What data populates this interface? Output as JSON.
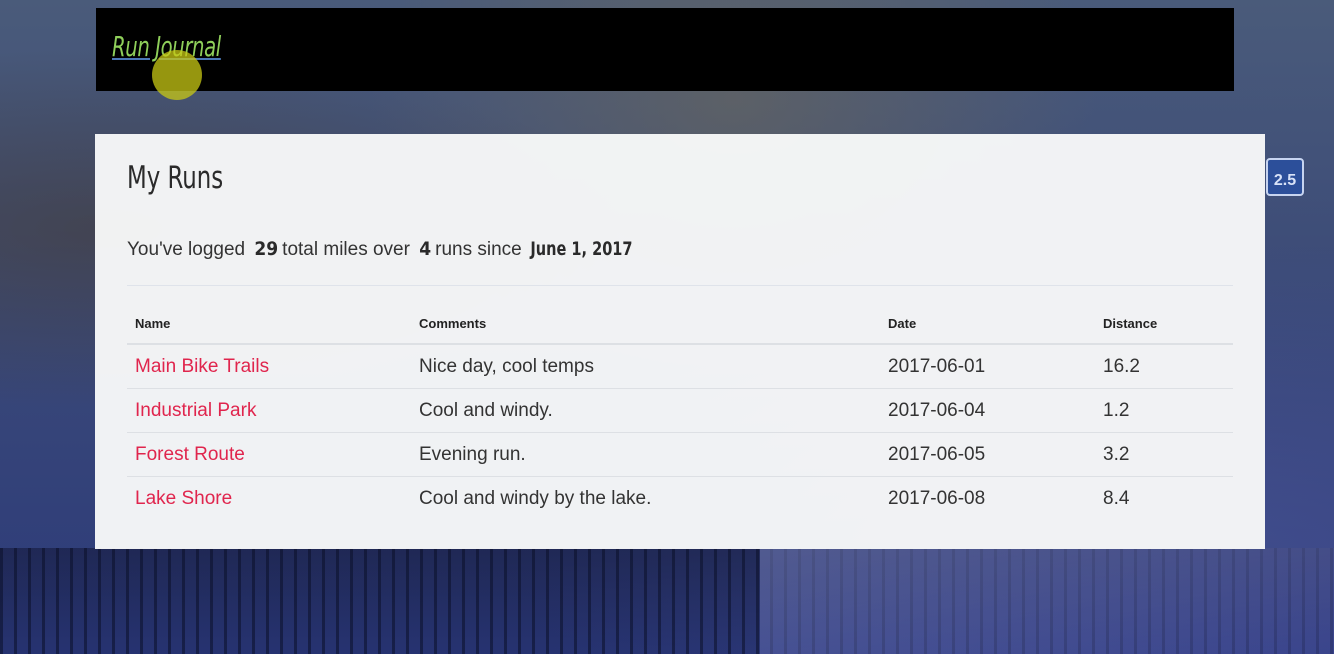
{
  "header": {
    "brand": "Run Journal"
  },
  "background": {
    "sign_text": "2.5"
  },
  "main": {
    "title": "My Runs",
    "summary": {
      "prefix": "You've logged",
      "total_miles": "29",
      "miles_text": "total miles over",
      "run_count": "4",
      "runs_text": "runs since",
      "since_date": "June 1, 2017"
    },
    "table": {
      "columns": [
        "Name",
        "Comments",
        "Date",
        "Distance"
      ],
      "rows": [
        {
          "name": "Main Bike Trails",
          "comments": "Nice day, cool temps",
          "date": "2017-06-01",
          "distance": "16.2"
        },
        {
          "name": "Industrial Park",
          "comments": "Cool and windy.",
          "date": "2017-06-04",
          "distance": "1.2"
        },
        {
          "name": "Forest Route",
          "comments": "Evening run.",
          "date": "2017-06-05",
          "distance": "3.2"
        },
        {
          "name": "Lake Shore",
          "comments": "Cool and windy by the lake.",
          "date": "2017-06-08",
          "distance": "8.4"
        }
      ]
    }
  },
  "colors": {
    "brand": "#8fcf5a",
    "link": "#e0254d",
    "header_bg": "#000000",
    "panel_bg": "#f7f8f8"
  }
}
